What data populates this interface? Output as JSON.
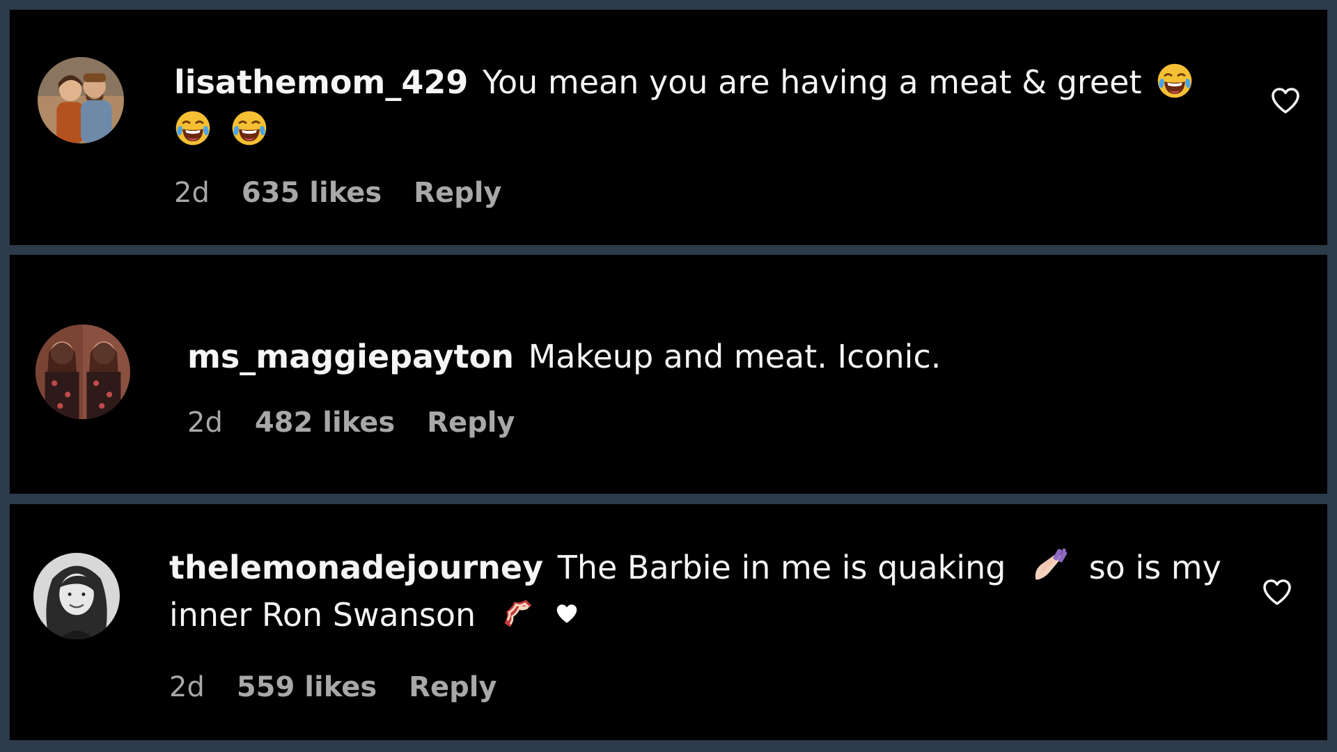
{
  "comments": [
    {
      "username": "lisathemom_429",
      "text": "You mean you are having a meat & greet",
      "emojis": [
        "face-with-tears-of-joy",
        "face-with-tears-of-joy",
        "face-with-tears-of-joy"
      ],
      "time": "2d",
      "likes": "635 likes",
      "reply": "Reply",
      "has_like_button": true
    },
    {
      "username": "ms_maggiepayton",
      "text": "Makeup and meat. Iconic.",
      "time": "2d",
      "likes": "482 likes",
      "reply": "Reply",
      "has_like_button": false
    },
    {
      "username": "thelemonadejourney",
      "text_part1": "The Barbie in me is quaking",
      "text_part2": "so is my inner Ron Swanson",
      "emojis": [
        "nail-polish",
        "bacon",
        "white-heart"
      ],
      "time": "2d",
      "likes": "559 likes",
      "reply": "Reply",
      "has_like_button": true
    }
  ],
  "colors": {
    "background": "#000000",
    "border": "#2c3a4a",
    "text": "#f5f5f5",
    "meta": "#a8a8a8"
  },
  "icons": {
    "like": "heart-outline-icon"
  }
}
